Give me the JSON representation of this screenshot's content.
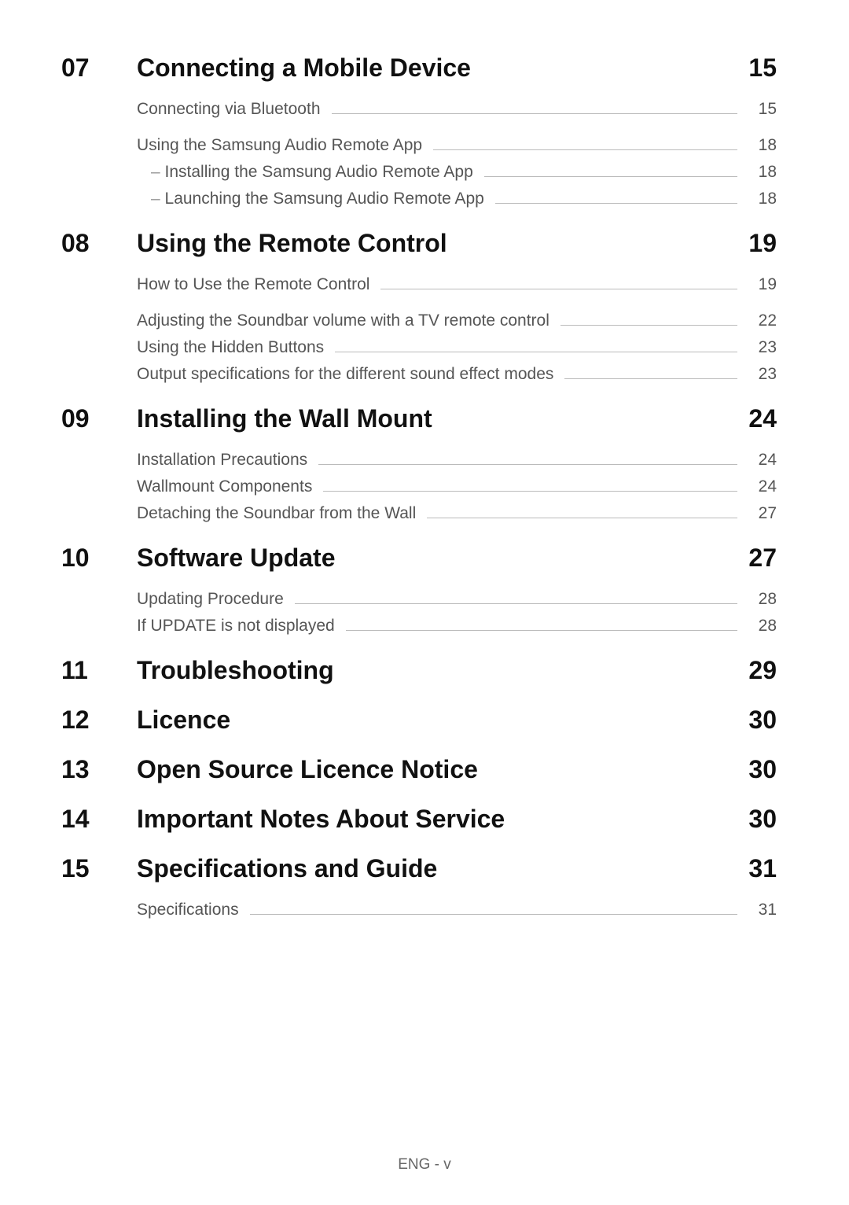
{
  "footer": "ENG - v",
  "sections": [
    {
      "num": "07",
      "title": "Connecting a Mobile Device",
      "page": "15",
      "entries": [
        {
          "label": "Connecting via Bluetooth",
          "page": "15",
          "lead": true
        },
        {
          "label": "Using the Samsung Audio Remote App",
          "page": "18",
          "lead": true
        },
        {
          "label": "Installing the Samsung Audio Remote App",
          "page": "18",
          "sub": true
        },
        {
          "label": "Launching the Samsung Audio Remote App",
          "page": "18",
          "sub": true
        }
      ]
    },
    {
      "num": "08",
      "title": "Using the Remote Control",
      "page": "19",
      "entries": [
        {
          "label": "How to Use the Remote Control",
          "page": "19",
          "lead": true
        },
        {
          "label": "Adjusting the Soundbar volume with a TV remote control",
          "page": "22",
          "lead": true
        },
        {
          "label": "Using the Hidden Buttons",
          "page": "23"
        },
        {
          "label": "Output specifications for the different sound effect modes",
          "page": "23"
        }
      ]
    },
    {
      "num": "09",
      "title": "Installing the Wall Mount",
      "page": "24",
      "entries": [
        {
          "label": "Installation Precautions",
          "page": "24",
          "lead": true
        },
        {
          "label": "Wallmount Components",
          "page": "24"
        },
        {
          "label": "Detaching the Soundbar from the Wall",
          "page": "27"
        }
      ]
    },
    {
      "num": "10",
      "title": "Software Update",
      "page": "27",
      "entries": [
        {
          "label": "Updating Procedure",
          "page": "28",
          "lead": true
        },
        {
          "label": "If UPDATE is not displayed",
          "page": "28"
        }
      ]
    },
    {
      "num": "11",
      "title": "Troubleshooting",
      "page": "29",
      "entries": []
    },
    {
      "num": "12",
      "title": "Licence",
      "page": "30",
      "entries": []
    },
    {
      "num": "13",
      "title": "Open Source Licence Notice",
      "page": "30",
      "entries": []
    },
    {
      "num": "14",
      "title": "Important Notes About Service",
      "page": "30",
      "entries": []
    },
    {
      "num": "15",
      "title": "Specifications and Guide",
      "page": "31",
      "entries": [
        {
          "label": "Specifications",
          "page": "31",
          "lead": true
        }
      ]
    }
  ]
}
